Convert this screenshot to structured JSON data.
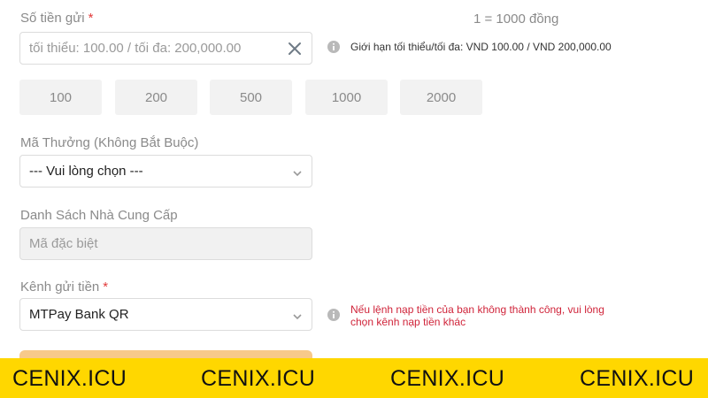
{
  "amount": {
    "label": "Số tiền gửi",
    "required_mark": "*",
    "placeholder": "tối thiểu: 100.00 / tối đa: 200,000.00",
    "rate": "1 = 1000 đồng",
    "limit_info": "Giới hạn tối thiểu/tối đa: VND 100.00 / VND 200,000.00",
    "quick_amounts": [
      "100",
      "200",
      "500",
      "1000",
      "2000"
    ]
  },
  "bonus": {
    "label": "Mã Thưởng (Không Bắt Buộc)",
    "selected": "--- Vui lòng chọn ---"
  },
  "provider": {
    "label": "Danh Sách Nhà Cung Cấp",
    "value": "Mã đặc biệt"
  },
  "channel": {
    "label": "Kênh gửi tiền",
    "required_mark": "*",
    "selected": "MTPay Bank QR",
    "warning_line1": "Nếu lệnh nạp tiền của bạn không thành công, vui lòng",
    "warning_line2": "chọn kênh nạp tiền khác"
  },
  "watermark": [
    "CENIX.ICU",
    "CENIX.ICU",
    "CENIX.ICU",
    "CENIX.ICU"
  ],
  "colors": {
    "banner": "#ffd700",
    "required": "#e23a3a",
    "warning": "#d0243a",
    "submit": "#f7c98a"
  }
}
